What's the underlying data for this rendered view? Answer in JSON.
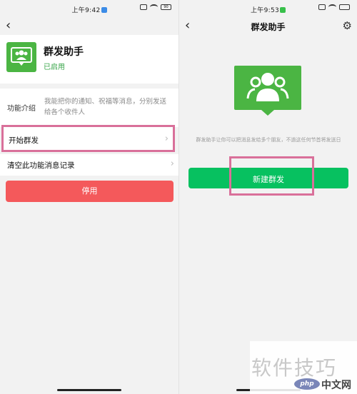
{
  "left": {
    "status": {
      "time": "上午9:42",
      "battery": "90"
    },
    "app": {
      "name": "群发助手",
      "status": "已启用"
    },
    "intro": {
      "label": "功能介绍",
      "text": "我能把你的通知、祝福等消息，分别发送给各个收件人"
    },
    "start_label": "开始群发",
    "clear_label": "清空此功能消息记录",
    "stop_label": "停用",
    "chevron": "›",
    "back": "‹"
  },
  "right": {
    "status": {
      "time": "上午9:53"
    },
    "title": "群发助手",
    "description": "群发助手让你可以把消息发给多个朋友，不過这任何节首将发送日",
    "new_label": "新建群发",
    "back": "‹",
    "gear": "⚙"
  },
  "watermark": {
    "text": "软件技巧",
    "logo_php": "php",
    "logo_cn": "中文网"
  },
  "colors": {
    "green": "#07c160",
    "icon_green": "#4bb543",
    "red": "#f4595b",
    "highlight": "#d9709a"
  }
}
